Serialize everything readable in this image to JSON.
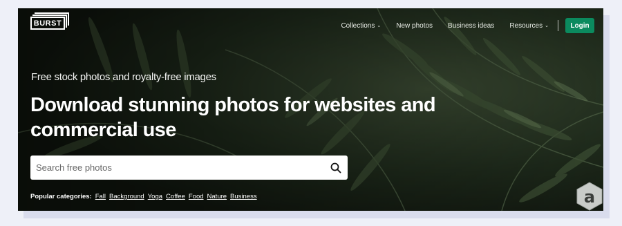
{
  "header": {
    "logo_text": "BURST",
    "nav": [
      {
        "label": "Collections",
        "has_dropdown": true
      },
      {
        "label": "New photos",
        "has_dropdown": false
      },
      {
        "label": "Business ideas",
        "has_dropdown": false
      },
      {
        "label": "Resources",
        "has_dropdown": true
      }
    ],
    "login_label": "Login",
    "caret_glyph": "⌄"
  },
  "hero": {
    "tagline": "Free stock photos and royalty-free images",
    "headline": "Download stunning photos for websites and commercial use"
  },
  "search": {
    "placeholder": "Search free photos",
    "value": "",
    "icon": "search-icon"
  },
  "popular": {
    "label": "Popular categories:",
    "categories": [
      "Fall",
      "Background",
      "Yoga",
      "Coffee",
      "Food",
      "Nature",
      "Business"
    ]
  },
  "badge": {
    "letter": "a"
  },
  "colors": {
    "login_bg": "#0b8a5e",
    "page_bg": "#eef0f8",
    "hero_dark": "#1b2519"
  }
}
